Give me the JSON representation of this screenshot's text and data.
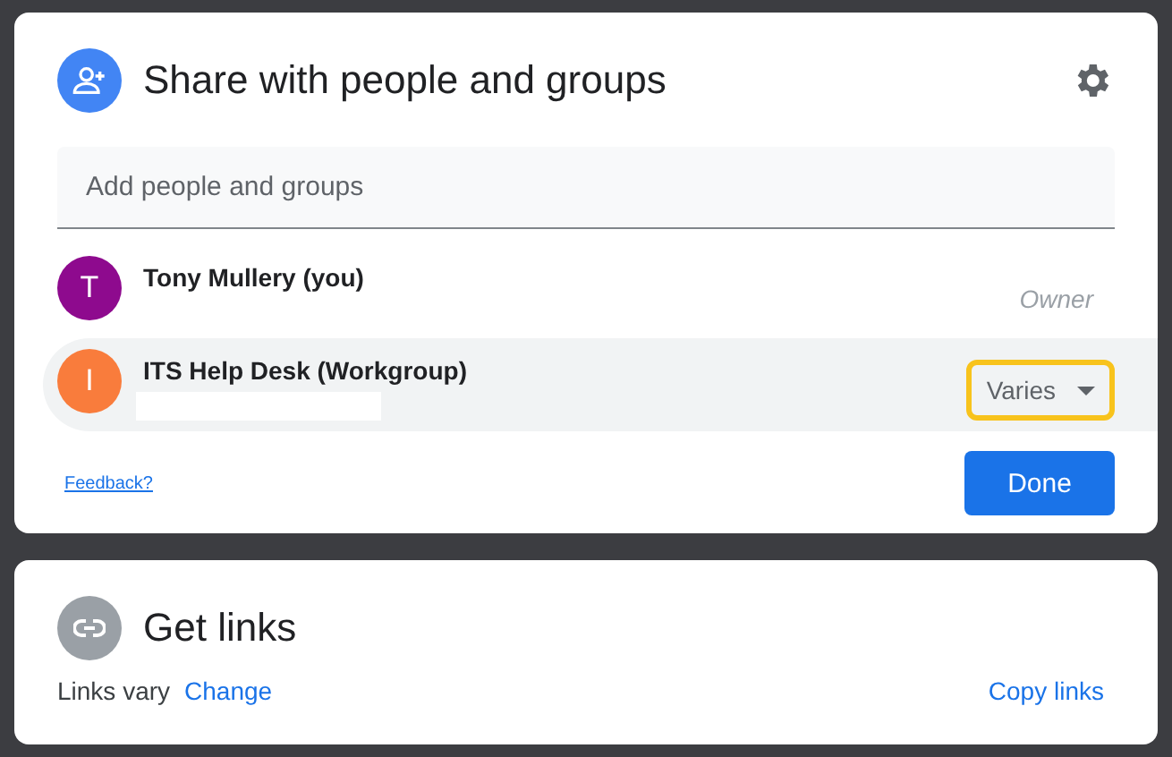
{
  "share_dialog": {
    "title": "Share with people and groups",
    "add_field": {
      "placeholder": "Add people and groups"
    },
    "people": [
      {
        "initial": "T",
        "name": "Tony Mullery (you)",
        "color": "#8e0a8e",
        "selected": false,
        "role": {
          "kind": "fixed",
          "label": "Owner"
        }
      },
      {
        "initial": "I",
        "name": "ITS Help Desk (Workgroup)",
        "color": "#f97c3c",
        "selected": true,
        "redacted": true,
        "role": {
          "kind": "dropdown",
          "label": "Varies",
          "highlighted": true
        }
      }
    ],
    "feedback": "Feedback?",
    "done": "Done"
  },
  "links_dialog": {
    "title": "Get links",
    "status": "Links vary",
    "change": "Change",
    "copy": "Copy links"
  }
}
